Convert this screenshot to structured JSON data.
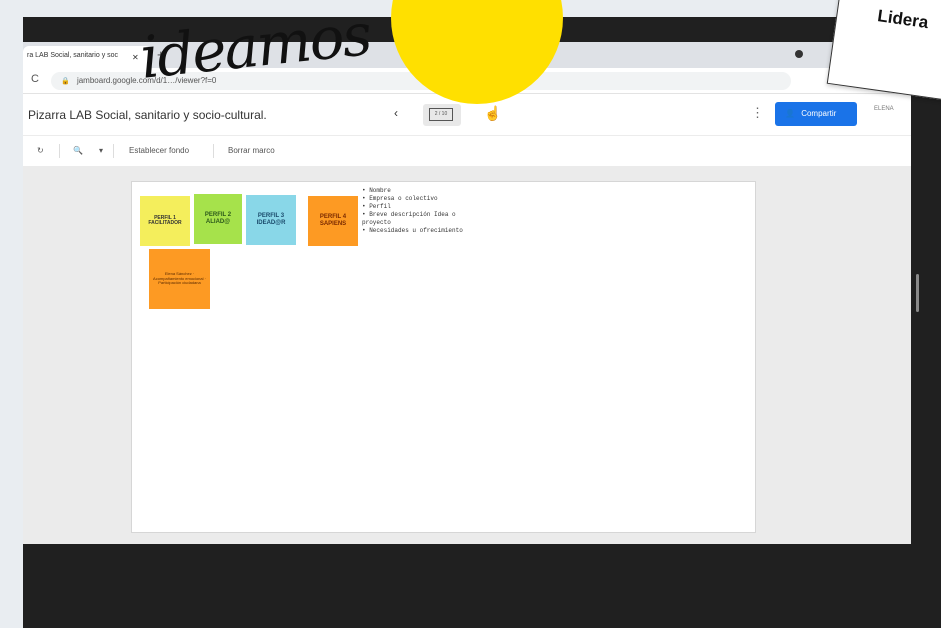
{
  "browser": {
    "tab_title": "ra LAB Social, sanitario y soc",
    "tab_close": "✕",
    "new_tab": "+",
    "reload": "C",
    "url": "jamboard.google.com/d/1…/viewer?f=0"
  },
  "app": {
    "title": "Pizarra LAB Social, sanitario y socio-cultural.",
    "prev": "‹",
    "frame_label": "2 / 10",
    "more": "⋮",
    "share_label": "Compartir",
    "user_badge": "ELENA",
    "toolbar": {
      "redo": "↻",
      "zoom": "🔍",
      "zoom_caret": "▾",
      "set_background": "Establecer fondo",
      "clear_frame": "Borrar marco"
    }
  },
  "board": {
    "stickies": [
      {
        "text": "PERFIL 1 FACILITADOR",
        "color": "#f4ee5c"
      },
      {
        "text": "PERFIL 2 ALIAD@",
        "color": "#a6e24b"
      },
      {
        "text": "PERFIL 3 IDEAD@R",
        "color": "#89d7e8"
      },
      {
        "text": "PERFIL 4 SAPIENS",
        "color": "#fd9a23"
      },
      {
        "text": "Elena Sánchez · Acompañamiento emocional · Participación ciudadana",
        "color": "#fd9a23"
      }
    ],
    "bullets": [
      "• Nombre",
      "• Empresa o colectivo",
      "• Perfil",
      "• Breve descripción Idea o",
      "  proyecto",
      "• Necesidades u ofrecimiento"
    ]
  },
  "overlay": {
    "handwriting": "ideamos",
    "card_text": "Lidera",
    "sun_color": "#ffe000"
  }
}
